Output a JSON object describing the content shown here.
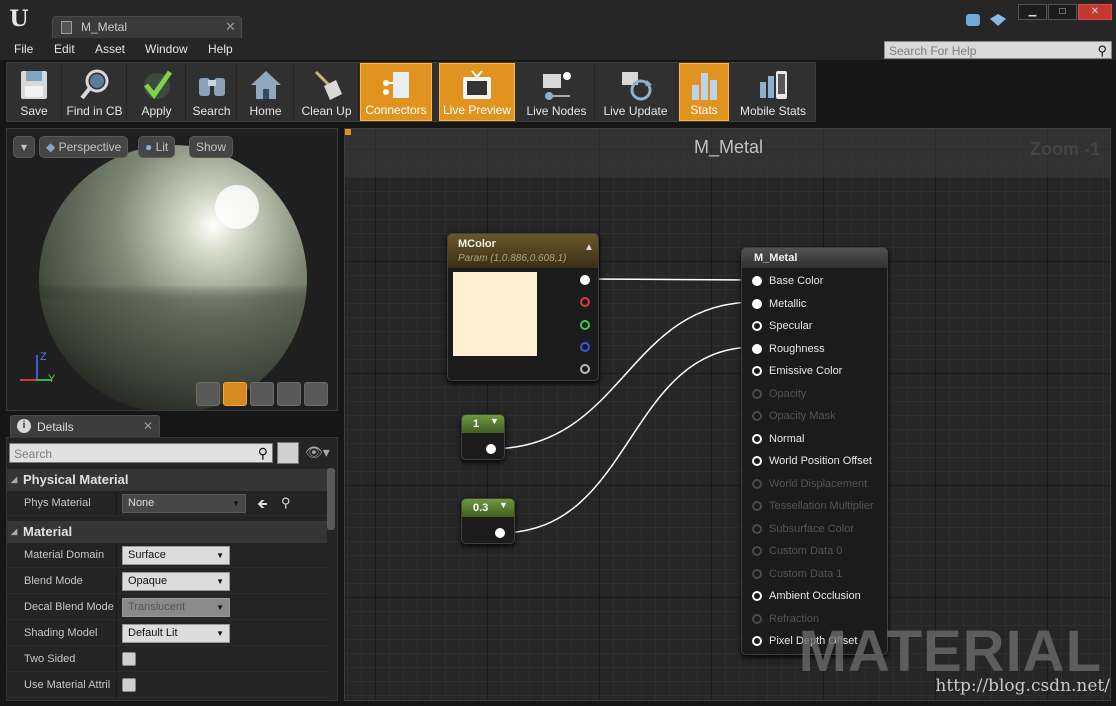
{
  "app": {
    "logo": "U",
    "tab_title": "M_Metal",
    "window_controls": [
      "▁",
      "□",
      "✕"
    ]
  },
  "menu": [
    "File",
    "Edit",
    "Asset",
    "Window",
    "Help"
  ],
  "help_search": {
    "placeholder": "Search For Help"
  },
  "toolbar": {
    "buttons": [
      {
        "label": "Save",
        "icon": "save-icon",
        "active": false
      },
      {
        "label": "Find in CB",
        "icon": "find-in-cb-icon",
        "active": false
      },
      {
        "label": "Apply",
        "icon": "apply-checkmark-icon",
        "active": false
      },
      {
        "label": "Search",
        "icon": "binoculars-icon",
        "active": false
      },
      {
        "label": "Home",
        "icon": "home-icon",
        "active": false
      },
      {
        "label": "Clean Up",
        "icon": "broom-icon",
        "active": false
      },
      {
        "label": "Connectors",
        "icon": "connectors-icon",
        "active": true
      },
      {
        "label": "Live Preview",
        "icon": "tv-icon",
        "active": true
      },
      {
        "label": "Live Nodes",
        "icon": "live-nodes-icon",
        "active": false
      },
      {
        "label": "Live Update",
        "icon": "live-update-icon",
        "active": false
      },
      {
        "label": "Stats",
        "icon": "stats-icon",
        "active": true
      },
      {
        "label": "Mobile Stats",
        "icon": "mobile-stats-icon",
        "active": false
      }
    ]
  },
  "viewport": {
    "perspective": "Perspective",
    "lit": "Lit",
    "show": "Show",
    "axis_z": "Z",
    "axis_y": "Y"
  },
  "details": {
    "tab": "Details",
    "search_placeholder": "Search",
    "sections": [
      {
        "title": "Physical Material",
        "props": [
          {
            "name": "Phys Material",
            "type": "asset",
            "value": "None"
          }
        ]
      },
      {
        "title": "Material",
        "props": [
          {
            "name": "Material Domain",
            "type": "combo",
            "value": "Surface"
          },
          {
            "name": "Blend Mode",
            "type": "combo",
            "value": "Opaque"
          },
          {
            "name": "Decal Blend Mode",
            "type": "combo",
            "value": "Translucent",
            "disabled": true
          },
          {
            "name": "Shading Model",
            "type": "combo",
            "value": "Default Lit"
          },
          {
            "name": "Two Sided",
            "type": "checkbox",
            "checked": false
          },
          {
            "name": "Use Material Attril",
            "type": "checkbox",
            "checked": false
          }
        ]
      }
    ]
  },
  "graph": {
    "title": "M_Metal",
    "zoom": "Zoom -1",
    "mcolor": {
      "title": "MColor",
      "subtitle": "Param (1,0.886,0.608,1)",
      "swatch": "#fff0d2"
    },
    "const1": {
      "value": "1"
    },
    "const2": {
      "value": "0.3"
    },
    "result": {
      "title": "M_Metal",
      "inputs": [
        {
          "label": "Base Color",
          "active": true,
          "connected": true
        },
        {
          "label": "Metallic",
          "active": true,
          "connected": true
        },
        {
          "label": "Specular",
          "active": true,
          "connected": false
        },
        {
          "label": "Roughness",
          "active": true,
          "connected": true
        },
        {
          "label": "Emissive Color",
          "active": true,
          "connected": false
        },
        {
          "label": "Opacity",
          "active": false,
          "connected": false
        },
        {
          "label": "Opacity Mask",
          "active": false,
          "connected": false
        },
        {
          "label": "Normal",
          "active": true,
          "connected": false
        },
        {
          "label": "World Position Offset",
          "active": true,
          "connected": false
        },
        {
          "label": "World Displacement",
          "active": false,
          "connected": false
        },
        {
          "label": "Tessellation Multiplier",
          "active": false,
          "connected": false
        },
        {
          "label": "Subsurface Color",
          "active": false,
          "connected": false
        },
        {
          "label": "Custom Data 0",
          "active": false,
          "connected": false
        },
        {
          "label": "Custom Data 1",
          "active": false,
          "connected": false
        },
        {
          "label": "Ambient Occlusion",
          "active": true,
          "connected": false
        },
        {
          "label": "Refraction",
          "active": false,
          "connected": false
        },
        {
          "label": "Pixel Depth Offset",
          "active": true,
          "connected": false
        }
      ]
    }
  },
  "watermark": "MATERIAL",
  "url": "http://blog.csdn.net/"
}
